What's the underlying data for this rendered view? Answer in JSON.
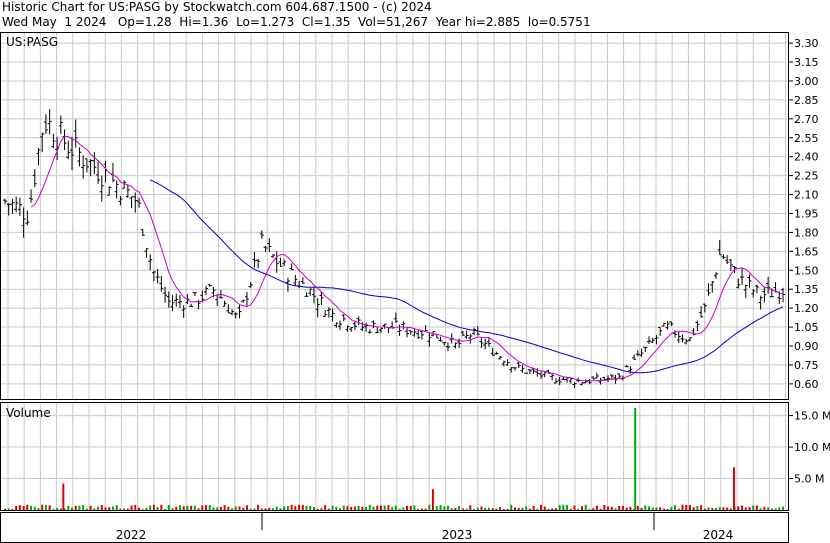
{
  "header": {
    "line1": "Historic Chart for US:PASG by Stockwatch.com 604.687.1500 - (c) 2024",
    "line2": "Wed May  1 2024   Op=1.28  Hi=1.36  Lo=1.273  Cl=1.35  Vol=51,267  Year hi=2.885  lo=0.5751"
  },
  "colors": {
    "price_bars": "#000000",
    "ma_short": "#cc00cc",
    "ma_long": "#0000cc",
    "vol_up": "#00aa00",
    "vol_down": "#dd0000",
    "grid": "#c8c8c8"
  },
  "chart_data": [
    {
      "type": "ohlc",
      "label": "US:PASG",
      "y_ticks": [
        "3.30",
        "3.15",
        "3.00",
        "2.85",
        "2.70",
        "2.55",
        "2.40",
        "2.25",
        "2.10",
        "1.95",
        "1.80",
        "1.65",
        "1.50",
        "1.35",
        "1.20",
        "1.05",
        "0.90",
        "0.75",
        "0.60"
      ],
      "ylim": [
        0.48,
        3.38
      ],
      "x_labels": [
        "2022",
        "2023",
        "2024"
      ],
      "approx_close_path": [
        {
          "t": 0.0,
          "v": 2.05
        },
        {
          "t": 0.03,
          "v": 1.95
        },
        {
          "t": 0.05,
          "v": 2.7
        },
        {
          "t": 0.08,
          "v": 2.5
        },
        {
          "t": 0.11,
          "v": 2.35
        },
        {
          "t": 0.14,
          "v": 2.2
        },
        {
          "t": 0.17,
          "v": 2.05
        },
        {
          "t": 0.19,
          "v": 1.5
        },
        {
          "t": 0.21,
          "v": 1.25
        },
        {
          "t": 0.24,
          "v": 1.25
        },
        {
          "t": 0.27,
          "v": 1.35
        },
        {
          "t": 0.3,
          "v": 1.1
        },
        {
          "t": 0.33,
          "v": 1.7
        },
        {
          "t": 0.36,
          "v": 1.5
        },
        {
          "t": 0.39,
          "v": 1.35
        },
        {
          "t": 0.42,
          "v": 1.15
        },
        {
          "t": 0.46,
          "v": 1.05
        },
        {
          "t": 0.5,
          "v": 1.05
        },
        {
          "t": 0.55,
          "v": 1.0
        },
        {
          "t": 0.58,
          "v": 0.9
        },
        {
          "t": 0.6,
          "v": 1.0
        },
        {
          "t": 0.63,
          "v": 0.85
        },
        {
          "t": 0.66,
          "v": 0.72
        },
        {
          "t": 0.7,
          "v": 0.65
        },
        {
          "t": 0.74,
          "v": 0.62
        },
        {
          "t": 0.79,
          "v": 0.65
        },
        {
          "t": 0.82,
          "v": 0.85
        },
        {
          "t": 0.85,
          "v": 1.05
        },
        {
          "t": 0.88,
          "v": 0.95
        },
        {
          "t": 0.9,
          "v": 1.2
        },
        {
          "t": 0.92,
          "v": 1.65
        },
        {
          "t": 0.94,
          "v": 1.45
        },
        {
          "t": 0.97,
          "v": 1.3
        },
        {
          "t": 1.0,
          "v": 1.35
        }
      ]
    },
    {
      "type": "bar",
      "label": "Volume",
      "y_ticks": [
        "15.0 M",
        "10.0 M",
        "5.0 M"
      ],
      "ylim": [
        0,
        17
      ],
      "spikes": [
        {
          "t": 0.075,
          "v": 4.2,
          "dir": "down"
        },
        {
          "t": 0.55,
          "v": 3.3,
          "dir": "down"
        },
        {
          "t": 0.81,
          "v": 16.2,
          "dir": "up"
        },
        {
          "t": 0.937,
          "v": 6.8,
          "dir": "down"
        }
      ]
    }
  ]
}
